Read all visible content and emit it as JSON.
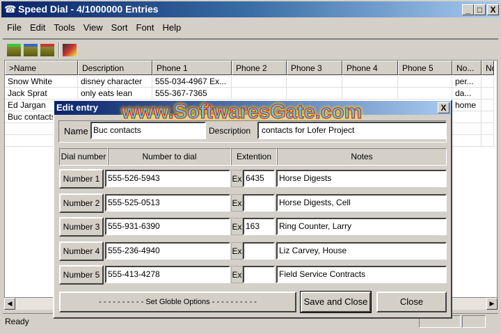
{
  "window": {
    "title": "Speed Dial - 4/1000000 Entries",
    "minimize": "_",
    "maximize": "□",
    "close": "X"
  },
  "menu": [
    "File",
    "Edit",
    "Tools",
    "View",
    "Sort",
    "Font",
    "Help"
  ],
  "toolbar": [
    "add-entry-icon",
    "edit-entry-icon",
    "delete-entry-icon",
    "dial-tools-icon"
  ],
  "list": {
    "columns": [
      ">Name",
      "Description",
      "Phone 1",
      "Phone 2",
      "Phone 3",
      "Phone 4",
      "Phone 5",
      "No...",
      "No"
    ],
    "rows": [
      [
        "Snow White",
        "disney character",
        "555-034-4967 Ex...",
        "",
        "",
        "",
        "",
        "per...",
        ""
      ],
      [
        "Jack Sprat",
        "only eats lean",
        "555-367-7365",
        "",
        "",
        "",
        "",
        "da...",
        ""
      ],
      [
        "Ed Jargan",
        "",
        "",
        "",
        "",
        "",
        "",
        "home",
        ""
      ],
      [
        "Buc contacts",
        "",
        "",
        "",
        "",
        "",
        "",
        "",
        ""
      ]
    ]
  },
  "status": "Ready",
  "dialog": {
    "title": "Edit entry",
    "close": "X",
    "name_label": "Name",
    "name_value": "Buc contacts",
    "description_label": "Description",
    "description_value": "contacts for Lofer Project",
    "headers": [
      "Dial number",
      "Number to dial",
      "Extention",
      "Notes"
    ],
    "ex_label": "Ex",
    "rows": [
      {
        "button": "Number 1",
        "number": "555-526-5943",
        "ext": "6435",
        "notes": "Horse Digests"
      },
      {
        "button": "Number 2",
        "number": "555-525-0513",
        "ext": "",
        "notes": "Horse Digests, Cell"
      },
      {
        "button": "Number 3",
        "number": "555-931-6390",
        "ext": "163",
        "notes": "Ring Counter, Larry"
      },
      {
        "button": "Number 4",
        "number": "555-236-4940",
        "ext": "",
        "notes": "Liz Carvey, House"
      },
      {
        "button": "Number 5",
        "number": "555-413-4278",
        "ext": "",
        "notes": "Field Service Contracts"
      }
    ],
    "global_options": "- - - - - - - - - - Set Globle Options - - - - - - - - - -",
    "save_close": "Save and Close",
    "close_button": "Close"
  },
  "watermark": "www.SoftwaresGate.com"
}
